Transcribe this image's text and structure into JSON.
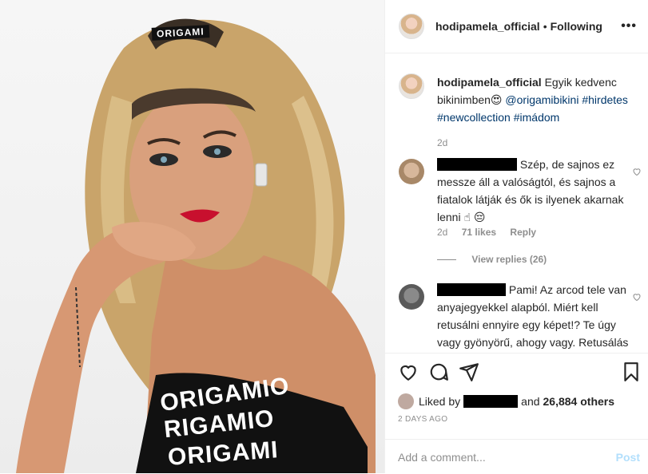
{
  "post": {
    "author": "hodipamela_official",
    "separator": "•",
    "follow_status": "Following",
    "more": "•••",
    "photo_logo_text": "ORIGAMI",
    "photo_top_print": "ORIGAMIO",
    "photo_mid_print": "RIGAMIO",
    "photo_bottom_print": "ORIGAMI"
  },
  "caption": {
    "user": "hodipamela_official",
    "text_before": "Egyik kedvenc bikinimben😍",
    "mention": "@origamibikini",
    "tags_line1": "#hirdetes",
    "tags_line2": "#newcollection #imádom",
    "time": "2d"
  },
  "comments": [
    {
      "text": "Szép, de sajnos ez messze áll a valóságtól, és sajnos a fiatalok látják és ők is ilyenek akarnak lenni ☝ 😔",
      "time": "2d",
      "likes": "71 likes",
      "reply": "Reply",
      "view_replies": "View replies (26)"
    },
    {
      "text": "Pami! Az arcod tele van anyajegyekkel alapból. Miért kell retusálni ennyire egy képet!? Te úgy vagy gyönyörű, ahogy vagy. Retusálás nélkül és természetesen!"
    }
  ],
  "likes": {
    "liked_by": "Liked by",
    "and": "and",
    "count": "26,884 others"
  },
  "date": "2 DAYS AGO",
  "add_comment": {
    "placeholder": "Add a comment...",
    "post_label": "Post"
  },
  "colors": {
    "link": "#00376b",
    "muted": "#8e8e8e",
    "post_disabled": "#b2dffc",
    "lipstick": "#c8102e"
  }
}
